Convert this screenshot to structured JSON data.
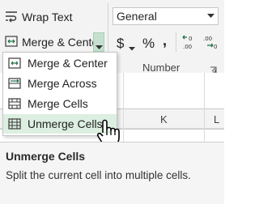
{
  "ribbon": {
    "wrap_text_label": "Wrap Text",
    "merge_center_label": "Merge & Center",
    "number_format_value": "General",
    "number_group_label": "Number",
    "currency_symbol": "$",
    "percent_symbol": "%",
    "comma_symbol": ","
  },
  "sheet": {
    "column_headers": [
      "K",
      "L"
    ]
  },
  "merge_menu": {
    "items": [
      {
        "label": "Merge & Center",
        "icon": "merge-center-icon"
      },
      {
        "label": "Merge Across",
        "icon": "merge-across-icon"
      },
      {
        "label": "Merge Cells",
        "icon": "merge-cells-icon"
      },
      {
        "label": "Unmerge Cells",
        "icon": "unmerge-cells-icon",
        "highlighted": true
      }
    ]
  },
  "tooltip": {
    "title": "Unmerge Cells",
    "body": "Split the current cell into multiple cells."
  },
  "colors": {
    "ribbon_bg": "#f3f3f3",
    "highlight": "#dcefe1",
    "accent_green": "#217346",
    "dropdown_arrow_bg": "#c6e0cf"
  }
}
